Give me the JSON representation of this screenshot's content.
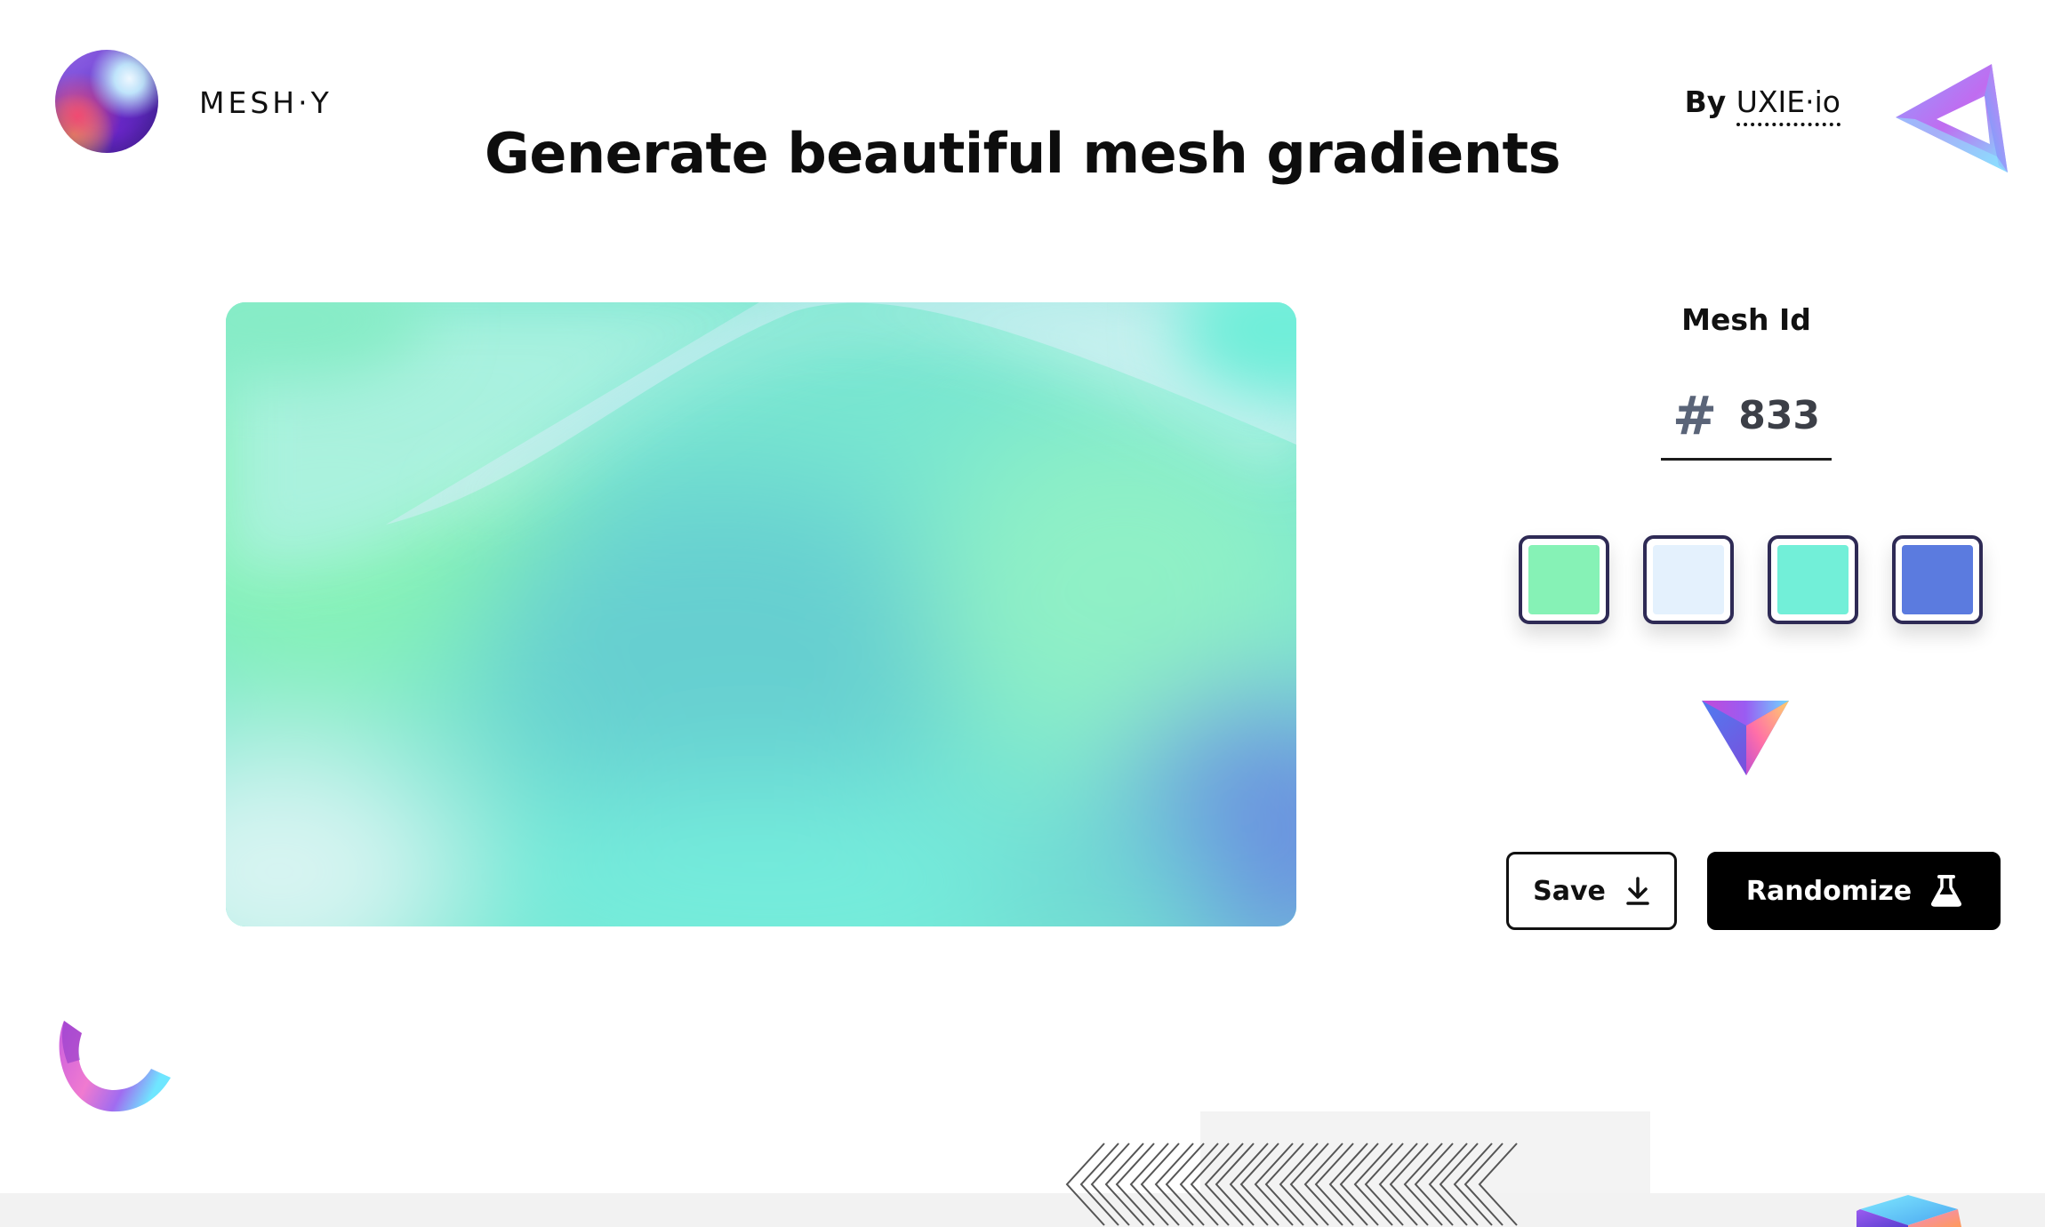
{
  "header": {
    "brand": "MESH·Y",
    "byline_prefix": "By ",
    "byline_link": "UXIE·io",
    "logo_icon": "gradient-sphere-icon",
    "corner_icon": "gradient-triangle-icon"
  },
  "title": "Generate beautiful mesh gradients",
  "mesh": {
    "label": "Mesh Id",
    "hash": "#",
    "id": "833"
  },
  "colors": {
    "palette": [
      "#86f2b6",
      "#e4f1fd",
      "#72efd8",
      "#5b7bdf"
    ],
    "swatch_border": "#2e2a55",
    "button_primary": "#000000"
  },
  "actions": {
    "save": "Save",
    "save_icon": "download-icon",
    "randomize": "Randomize",
    "randomize_icon": "flask-icon"
  }
}
